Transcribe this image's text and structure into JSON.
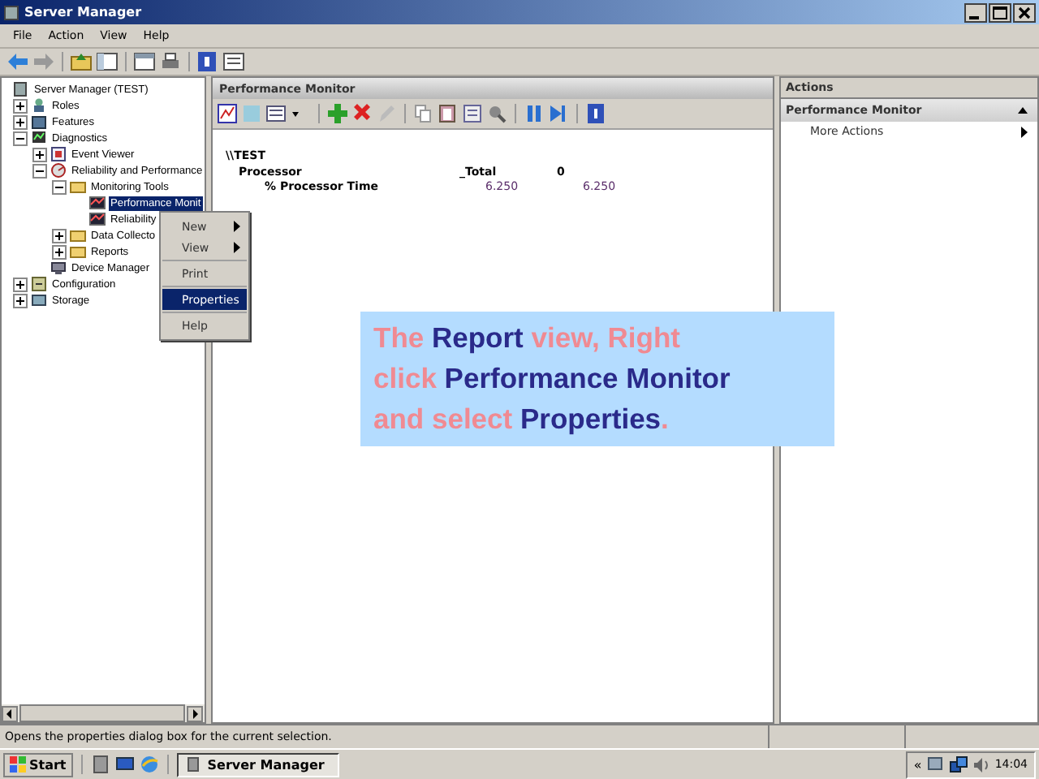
{
  "window": {
    "title": "Server Manager"
  },
  "menu": [
    "File",
    "Action",
    "View",
    "Help"
  ],
  "tree": [
    {
      "label": "Server Manager (TEST)",
      "children": [
        {
          "label": "Roles",
          "expanded": false
        },
        {
          "label": "Features",
          "expanded": false
        },
        {
          "label": "Diagnostics",
          "expanded": true,
          "children": [
            {
              "label": "Event Viewer",
              "expanded": false
            },
            {
              "label": "Reliability and Performance",
              "expanded": true,
              "children": [
                {
                  "label": "Monitoring Tools",
                  "expanded": true,
                  "children": [
                    {
                      "label": "Performance Monit",
                      "selected": true
                    },
                    {
                      "label": "Reliability",
                      "selected": false
                    }
                  ]
                },
                {
                  "label": "Data Collecto",
                  "expanded": false
                },
                {
                  "label": "Reports",
                  "expanded": false
                }
              ]
            },
            {
              "label": "Device Manager"
            }
          ]
        },
        {
          "label": "Configuration",
          "expanded": false
        },
        {
          "label": "Storage",
          "expanded": false
        }
      ]
    }
  ],
  "context_menu": [
    {
      "kind": "item",
      "label": "New",
      "submenu": true,
      "selected": false
    },
    {
      "kind": "item",
      "label": "View",
      "submenu": true,
      "selected": false
    },
    {
      "kind": "separator"
    },
    {
      "kind": "item",
      "label": "Print",
      "submenu": false,
      "selected": false
    },
    {
      "kind": "separator"
    },
    {
      "kind": "item",
      "label": "Properties",
      "submenu": false,
      "selected": true
    },
    {
      "kind": "separator"
    },
    {
      "kind": "item",
      "label": "Help",
      "submenu": false,
      "selected": false
    }
  ],
  "center": {
    "title": "Performance Monitor",
    "report": {
      "machine": "\\\\TEST",
      "object": "Processor",
      "instances": [
        "_Total",
        "0"
      ],
      "counters": [
        {
          "name": "% Processor Time",
          "values": [
            "6.250",
            "6.250"
          ]
        }
      ]
    }
  },
  "caption": "The *Report* view, Right click *Performance Monitor* and select *Properties*.",
  "actions": {
    "title": "Actions",
    "section": "Performance Monitor",
    "items": [
      "More Actions"
    ]
  },
  "status_bar": "Opens the properties dialog box for the current selection.",
  "taskbar": {
    "start": "Start",
    "tasks": [
      {
        "label": "Server Manager",
        "selected": true
      }
    ],
    "tray_expand": "«",
    "clock": "14:04"
  }
}
